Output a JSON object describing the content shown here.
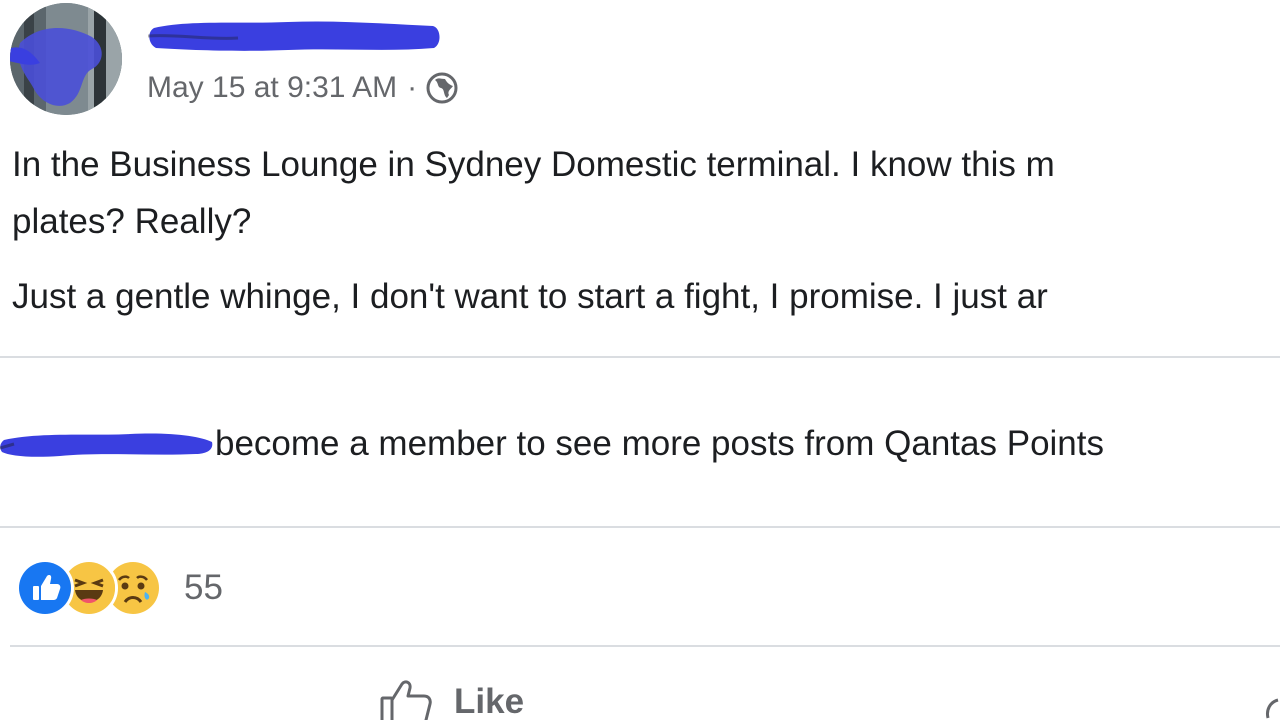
{
  "post": {
    "author": {
      "avatar_icon": "profile-photo-avatar",
      "name_redacted": true
    },
    "timestamp": "May 15 at 9:31 AM",
    "separator": "·",
    "privacy_icon": "globe-icon",
    "text_lines": [
      "In the Business Lounge in Sydney Domestic terminal.  I know this m",
      "plates?  Really?",
      "Just a gentle whinge, I don't want to start a fight, I promise. I just ar"
    ]
  },
  "member_notice": {
    "name_redacted": true,
    "text": "become a member to see more posts from Qantas Points"
  },
  "reactions": {
    "icons": [
      "like-reaction-icon",
      "haha-reaction-icon",
      "sad-reaction-icon"
    ],
    "count": "55"
  },
  "actions": {
    "like_label": "Like"
  },
  "colors": {
    "like_blue": "#1877f2",
    "emoji_yellow": "#f7c544",
    "redaction_blue": "#3a3fe0",
    "secondary_text": "#65676b",
    "divider": "#dadde1"
  }
}
